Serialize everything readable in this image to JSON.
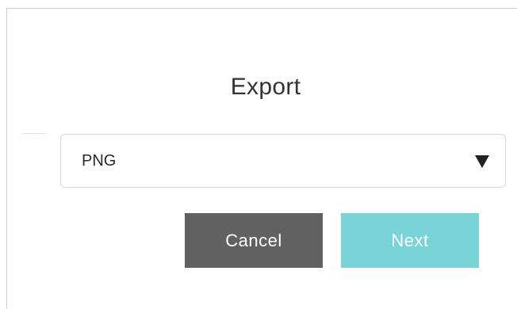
{
  "dialog": {
    "title": "Export",
    "format_select": {
      "selected": "PNG"
    },
    "buttons": {
      "cancel_label": "Cancel",
      "next_label": "Next"
    }
  },
  "colors": {
    "cancel_bg": "#616161",
    "next_bg": "#79d4d8",
    "title_text": "#333333"
  },
  "icons": {
    "caret": "caret-down-icon"
  }
}
